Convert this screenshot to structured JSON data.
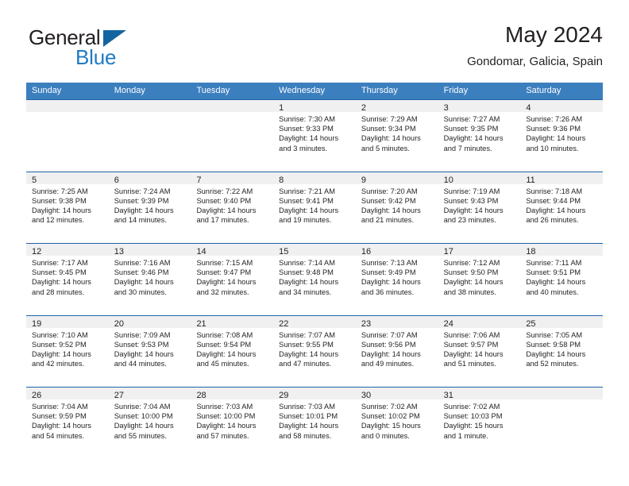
{
  "brand": {
    "name_top": "General",
    "name_bottom": "Blue",
    "triangle_color": "#1464a0",
    "blue_color": "#1f7ac4"
  },
  "header": {
    "title": "May 2024",
    "subtitle": "Gondomar, Galicia, Spain"
  },
  "theme": {
    "header_row_bg": "#3c7fbf",
    "row_border": "#1f63a8",
    "day_band_bg": "#f0f0f0",
    "text": "#231f20"
  },
  "weekdays": [
    "Sunday",
    "Monday",
    "Tuesday",
    "Wednesday",
    "Thursday",
    "Friday",
    "Saturday"
  ],
  "weeks": [
    [
      {
        "day": "",
        "sunrise": "",
        "sunset": "",
        "daylight_line1": "",
        "daylight_line2": ""
      },
      {
        "day": "",
        "sunrise": "",
        "sunset": "",
        "daylight_line1": "",
        "daylight_line2": ""
      },
      {
        "day": "",
        "sunrise": "",
        "sunset": "",
        "daylight_line1": "",
        "daylight_line2": ""
      },
      {
        "day": "1",
        "sunrise": "Sunrise: 7:30 AM",
        "sunset": "Sunset: 9:33 PM",
        "daylight_line1": "Daylight: 14 hours",
        "daylight_line2": "and 3 minutes."
      },
      {
        "day": "2",
        "sunrise": "Sunrise: 7:29 AM",
        "sunset": "Sunset: 9:34 PM",
        "daylight_line1": "Daylight: 14 hours",
        "daylight_line2": "and 5 minutes."
      },
      {
        "day": "3",
        "sunrise": "Sunrise: 7:27 AM",
        "sunset": "Sunset: 9:35 PM",
        "daylight_line1": "Daylight: 14 hours",
        "daylight_line2": "and 7 minutes."
      },
      {
        "day": "4",
        "sunrise": "Sunrise: 7:26 AM",
        "sunset": "Sunset: 9:36 PM",
        "daylight_line1": "Daylight: 14 hours",
        "daylight_line2": "and 10 minutes."
      }
    ],
    [
      {
        "day": "5",
        "sunrise": "Sunrise: 7:25 AM",
        "sunset": "Sunset: 9:38 PM",
        "daylight_line1": "Daylight: 14 hours",
        "daylight_line2": "and 12 minutes."
      },
      {
        "day": "6",
        "sunrise": "Sunrise: 7:24 AM",
        "sunset": "Sunset: 9:39 PM",
        "daylight_line1": "Daylight: 14 hours",
        "daylight_line2": "and 14 minutes."
      },
      {
        "day": "7",
        "sunrise": "Sunrise: 7:22 AM",
        "sunset": "Sunset: 9:40 PM",
        "daylight_line1": "Daylight: 14 hours",
        "daylight_line2": "and 17 minutes."
      },
      {
        "day": "8",
        "sunrise": "Sunrise: 7:21 AM",
        "sunset": "Sunset: 9:41 PM",
        "daylight_line1": "Daylight: 14 hours",
        "daylight_line2": "and 19 minutes."
      },
      {
        "day": "9",
        "sunrise": "Sunrise: 7:20 AM",
        "sunset": "Sunset: 9:42 PM",
        "daylight_line1": "Daylight: 14 hours",
        "daylight_line2": "and 21 minutes."
      },
      {
        "day": "10",
        "sunrise": "Sunrise: 7:19 AM",
        "sunset": "Sunset: 9:43 PM",
        "daylight_line1": "Daylight: 14 hours",
        "daylight_line2": "and 23 minutes."
      },
      {
        "day": "11",
        "sunrise": "Sunrise: 7:18 AM",
        "sunset": "Sunset: 9:44 PM",
        "daylight_line1": "Daylight: 14 hours",
        "daylight_line2": "and 26 minutes."
      }
    ],
    [
      {
        "day": "12",
        "sunrise": "Sunrise: 7:17 AM",
        "sunset": "Sunset: 9:45 PM",
        "daylight_line1": "Daylight: 14 hours",
        "daylight_line2": "and 28 minutes."
      },
      {
        "day": "13",
        "sunrise": "Sunrise: 7:16 AM",
        "sunset": "Sunset: 9:46 PM",
        "daylight_line1": "Daylight: 14 hours",
        "daylight_line2": "and 30 minutes."
      },
      {
        "day": "14",
        "sunrise": "Sunrise: 7:15 AM",
        "sunset": "Sunset: 9:47 PM",
        "daylight_line1": "Daylight: 14 hours",
        "daylight_line2": "and 32 minutes."
      },
      {
        "day": "15",
        "sunrise": "Sunrise: 7:14 AM",
        "sunset": "Sunset: 9:48 PM",
        "daylight_line1": "Daylight: 14 hours",
        "daylight_line2": "and 34 minutes."
      },
      {
        "day": "16",
        "sunrise": "Sunrise: 7:13 AM",
        "sunset": "Sunset: 9:49 PM",
        "daylight_line1": "Daylight: 14 hours",
        "daylight_line2": "and 36 minutes."
      },
      {
        "day": "17",
        "sunrise": "Sunrise: 7:12 AM",
        "sunset": "Sunset: 9:50 PM",
        "daylight_line1": "Daylight: 14 hours",
        "daylight_line2": "and 38 minutes."
      },
      {
        "day": "18",
        "sunrise": "Sunrise: 7:11 AM",
        "sunset": "Sunset: 9:51 PM",
        "daylight_line1": "Daylight: 14 hours",
        "daylight_line2": "and 40 minutes."
      }
    ],
    [
      {
        "day": "19",
        "sunrise": "Sunrise: 7:10 AM",
        "sunset": "Sunset: 9:52 PM",
        "daylight_line1": "Daylight: 14 hours",
        "daylight_line2": "and 42 minutes."
      },
      {
        "day": "20",
        "sunrise": "Sunrise: 7:09 AM",
        "sunset": "Sunset: 9:53 PM",
        "daylight_line1": "Daylight: 14 hours",
        "daylight_line2": "and 44 minutes."
      },
      {
        "day": "21",
        "sunrise": "Sunrise: 7:08 AM",
        "sunset": "Sunset: 9:54 PM",
        "daylight_line1": "Daylight: 14 hours",
        "daylight_line2": "and 45 minutes."
      },
      {
        "day": "22",
        "sunrise": "Sunrise: 7:07 AM",
        "sunset": "Sunset: 9:55 PM",
        "daylight_line1": "Daylight: 14 hours",
        "daylight_line2": "and 47 minutes."
      },
      {
        "day": "23",
        "sunrise": "Sunrise: 7:07 AM",
        "sunset": "Sunset: 9:56 PM",
        "daylight_line1": "Daylight: 14 hours",
        "daylight_line2": "and 49 minutes."
      },
      {
        "day": "24",
        "sunrise": "Sunrise: 7:06 AM",
        "sunset": "Sunset: 9:57 PM",
        "daylight_line1": "Daylight: 14 hours",
        "daylight_line2": "and 51 minutes."
      },
      {
        "day": "25",
        "sunrise": "Sunrise: 7:05 AM",
        "sunset": "Sunset: 9:58 PM",
        "daylight_line1": "Daylight: 14 hours",
        "daylight_line2": "and 52 minutes."
      }
    ],
    [
      {
        "day": "26",
        "sunrise": "Sunrise: 7:04 AM",
        "sunset": "Sunset: 9:59 PM",
        "daylight_line1": "Daylight: 14 hours",
        "daylight_line2": "and 54 minutes."
      },
      {
        "day": "27",
        "sunrise": "Sunrise: 7:04 AM",
        "sunset": "Sunset: 10:00 PM",
        "daylight_line1": "Daylight: 14 hours",
        "daylight_line2": "and 55 minutes."
      },
      {
        "day": "28",
        "sunrise": "Sunrise: 7:03 AM",
        "sunset": "Sunset: 10:00 PM",
        "daylight_line1": "Daylight: 14 hours",
        "daylight_line2": "and 57 minutes."
      },
      {
        "day": "29",
        "sunrise": "Sunrise: 7:03 AM",
        "sunset": "Sunset: 10:01 PM",
        "daylight_line1": "Daylight: 14 hours",
        "daylight_line2": "and 58 minutes."
      },
      {
        "day": "30",
        "sunrise": "Sunrise: 7:02 AM",
        "sunset": "Sunset: 10:02 PM",
        "daylight_line1": "Daylight: 15 hours",
        "daylight_line2": "and 0 minutes."
      },
      {
        "day": "31",
        "sunrise": "Sunrise: 7:02 AM",
        "sunset": "Sunset: 10:03 PM",
        "daylight_line1": "Daylight: 15 hours",
        "daylight_line2": "and 1 minute."
      },
      {
        "day": "",
        "sunrise": "",
        "sunset": "",
        "daylight_line1": "",
        "daylight_line2": ""
      }
    ]
  ]
}
